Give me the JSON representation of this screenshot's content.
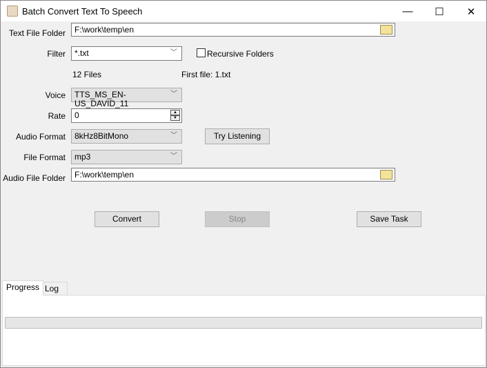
{
  "window": {
    "title": "Batch Convert Text To Speech",
    "minimize": "—",
    "maximize": "☐",
    "close": "✕"
  },
  "form": {
    "text_folder_label": "Text File Folder",
    "text_folder_value": "F:\\work\\temp\\en",
    "filter_label": "Filter",
    "filter_value": "*.txt",
    "recursive_label": "Recursive Folders",
    "recursive_checked": false,
    "file_count": "12 Files",
    "first_file": "First file: 1.txt",
    "voice_label": "Voice",
    "voice_value": "TTS_MS_EN-US_DAVID_11",
    "rate_label": "Rate",
    "rate_value": "0",
    "audio_format_label": "Audio Format",
    "audio_format_value": "8kHz8BitMono",
    "try_listening": "Try Listening",
    "file_format_label": "File Format",
    "file_format_value": "mp3",
    "audio_folder_label": "Audio File Folder",
    "audio_folder_value": "F:\\work\\temp\\en"
  },
  "actions": {
    "convert": "Convert",
    "stop": "Stop",
    "save_task": "Save Task"
  },
  "tabs": [
    {
      "label": "Progress"
    },
    {
      "label": "Log"
    }
  ],
  "progress": {
    "value": 0
  }
}
